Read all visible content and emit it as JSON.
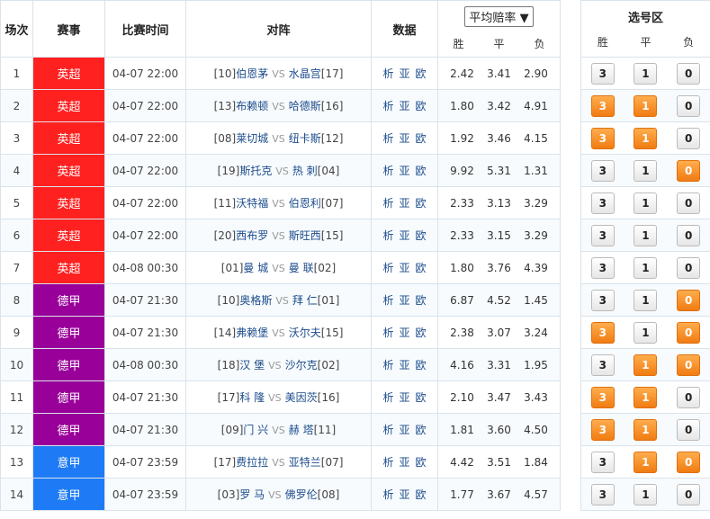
{
  "header": {
    "col_index": "场次",
    "col_league": "赛事",
    "col_time": "比赛时间",
    "col_match": "对阵",
    "col_data": "数据",
    "odds_select": "平均赔率",
    "odds_select_arrow": "▼",
    "sub_win": "胜",
    "sub_draw": "平",
    "sub_lose": "负",
    "pick_title": "选号区"
  },
  "links": {
    "analysis": "析",
    "asian": "亚",
    "euro": "欧"
  },
  "vs_label": "VS",
  "colors": {
    "英超": "#ff2020",
    "德甲": "#990099",
    "意甲": "#1e7bf5",
    "pick_on": "#f58a1f"
  },
  "rows": [
    {
      "idx": "1",
      "league": "英超",
      "time": "04-07 22:00",
      "home_rank": "[10]",
      "home": "伯恩茅",
      "away": "水晶宫",
      "away_rank": "[17]",
      "w": "2.42",
      "d": "3.41",
      "l": "2.90",
      "p3": "3",
      "p1": "1",
      "p0": "0",
      "on": [
        false,
        false,
        false
      ]
    },
    {
      "idx": "2",
      "league": "英超",
      "time": "04-07 22:00",
      "home_rank": "[13]",
      "home": "布赖顿",
      "away": "哈德斯",
      "away_rank": "[16]",
      "w": "1.80",
      "d": "3.42",
      "l": "4.91",
      "p3": "3",
      "p1": "1",
      "p0": "0",
      "on": [
        true,
        true,
        false
      ]
    },
    {
      "idx": "3",
      "league": "英超",
      "time": "04-07 22:00",
      "home_rank": "[08]",
      "home": "莱切城",
      "away": "纽卡斯",
      "away_rank": "[12]",
      "w": "1.92",
      "d": "3.46",
      "l": "4.15",
      "p3": "3",
      "p1": "1",
      "p0": "0",
      "on": [
        true,
        true,
        false
      ]
    },
    {
      "idx": "4",
      "league": "英超",
      "time": "04-07 22:00",
      "home_rank": "[19]",
      "home": "斯托克",
      "away": "热 刺",
      "away_rank": "[04]",
      "w": "9.92",
      "d": "5.31",
      "l": "1.31",
      "p3": "3",
      "p1": "1",
      "p0": "0",
      "on": [
        false,
        false,
        true
      ]
    },
    {
      "idx": "5",
      "league": "英超",
      "time": "04-07 22:00",
      "home_rank": "[11]",
      "home": "沃特福",
      "away": "伯恩利",
      "away_rank": "[07]",
      "w": "2.33",
      "d": "3.13",
      "l": "3.29",
      "p3": "3",
      "p1": "1",
      "p0": "0",
      "on": [
        false,
        false,
        false
      ]
    },
    {
      "idx": "6",
      "league": "英超",
      "time": "04-07 22:00",
      "home_rank": "[20]",
      "home": "西布罗",
      "away": "斯旺西",
      "away_rank": "[15]",
      "w": "2.33",
      "d": "3.15",
      "l": "3.29",
      "p3": "3",
      "p1": "1",
      "p0": "0",
      "on": [
        false,
        false,
        false
      ]
    },
    {
      "idx": "7",
      "league": "英超",
      "time": "04-08 00:30",
      "home_rank": "[01]",
      "home": "曼 城",
      "away": "曼 联",
      "away_rank": "[02]",
      "w": "1.80",
      "d": "3.76",
      "l": "4.39",
      "p3": "3",
      "p1": "1",
      "p0": "0",
      "on": [
        false,
        false,
        false
      ]
    },
    {
      "idx": "8",
      "league": "德甲",
      "time": "04-07 21:30",
      "home_rank": "[10]",
      "home": "奥格斯",
      "away": "拜 仁",
      "away_rank": "[01]",
      "w": "6.87",
      "d": "4.52",
      "l": "1.45",
      "p3": "3",
      "p1": "1",
      "p0": "0",
      "on": [
        false,
        false,
        true
      ]
    },
    {
      "idx": "9",
      "league": "德甲",
      "time": "04-07 21:30",
      "home_rank": "[14]",
      "home": "弗赖堡",
      "away": "沃尔夫",
      "away_rank": "[15]",
      "w": "2.38",
      "d": "3.07",
      "l": "3.24",
      "p3": "3",
      "p1": "1",
      "p0": "0",
      "on": [
        true,
        false,
        true
      ]
    },
    {
      "idx": "10",
      "league": "德甲",
      "time": "04-08 00:30",
      "home_rank": "[18]",
      "home": "汉 堡",
      "away": "沙尔克",
      "away_rank": "[02]",
      "w": "4.16",
      "d": "3.31",
      "l": "1.95",
      "p3": "3",
      "p1": "1",
      "p0": "0",
      "on": [
        false,
        true,
        true
      ]
    },
    {
      "idx": "11",
      "league": "德甲",
      "time": "04-07 21:30",
      "home_rank": "[17]",
      "home": "科 隆",
      "away": "美因茨",
      "away_rank": "[16]",
      "w": "2.10",
      "d": "3.47",
      "l": "3.43",
      "p3": "3",
      "p1": "1",
      "p0": "0",
      "on": [
        true,
        true,
        false
      ]
    },
    {
      "idx": "12",
      "league": "德甲",
      "time": "04-07 21:30",
      "home_rank": "[09]",
      "home": "门 兴",
      "away": "赫 塔",
      "away_rank": "[11]",
      "w": "1.81",
      "d": "3.60",
      "l": "4.50",
      "p3": "3",
      "p1": "1",
      "p0": "0",
      "on": [
        true,
        true,
        false
      ]
    },
    {
      "idx": "13",
      "league": "意甲",
      "time": "04-07 23:59",
      "home_rank": "[17]",
      "home": "费拉拉",
      "away": "亚特兰",
      "away_rank": "[07]",
      "w": "4.42",
      "d": "3.51",
      "l": "1.84",
      "p3": "3",
      "p1": "1",
      "p0": "0",
      "on": [
        false,
        true,
        true
      ]
    },
    {
      "idx": "14",
      "league": "意甲",
      "time": "04-07 23:59",
      "home_rank": "[03]",
      "home": "罗 马",
      "away": "佛罗伦",
      "away_rank": "[08]",
      "w": "1.77",
      "d": "3.67",
      "l": "4.57",
      "p3": "3",
      "p1": "1",
      "p0": "0",
      "on": [
        false,
        false,
        false
      ]
    }
  ]
}
